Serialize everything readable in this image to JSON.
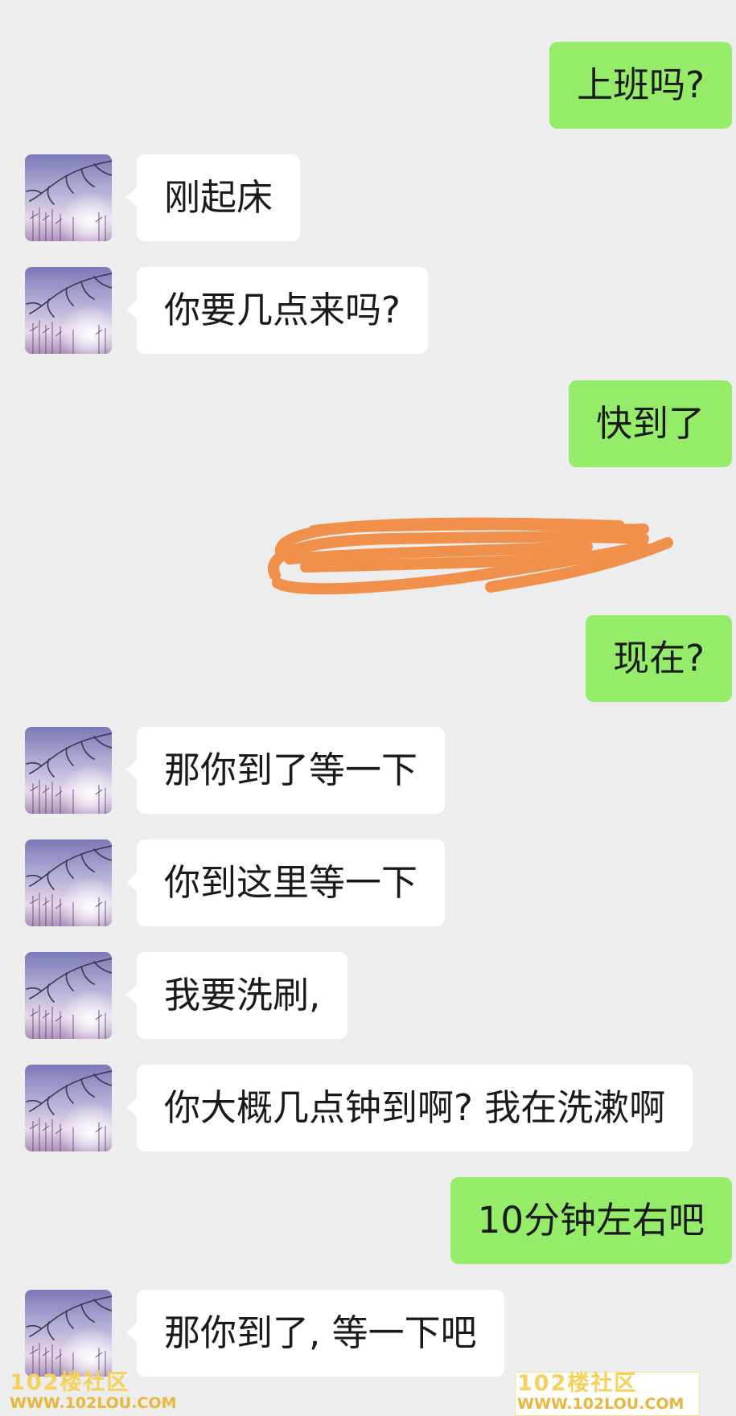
{
  "messages": [
    {
      "side": "right",
      "text": "上班吗?"
    },
    {
      "side": "left",
      "text": "刚起床"
    },
    {
      "side": "left",
      "text": "你要几点来吗?"
    },
    {
      "side": "right",
      "text": "快到了"
    },
    {
      "side": "right",
      "text": "现在?"
    },
    {
      "side": "left",
      "text": "那你到了等一下"
    },
    {
      "side": "left",
      "text": "你到这里等一下"
    },
    {
      "side": "left",
      "text": "我要洗刷,"
    },
    {
      "side": "left",
      "text": "你大概几点钟到啊? 我在洗漱啊"
    },
    {
      "side": "right",
      "text": "10分钟左右吧"
    },
    {
      "side": "left",
      "text": "那你到了, 等一下吧"
    }
  ],
  "watermark": {
    "title": "102楼社区",
    "url": "WWW.102LOU.COM"
  },
  "colors": {
    "background": "#ededed",
    "sent_bubble": "#95ec69",
    "received_bubble": "#ffffff",
    "redaction_scribble": "#f0904a"
  },
  "icons": {
    "avatar": "winter-tree-photo-avatar"
  }
}
